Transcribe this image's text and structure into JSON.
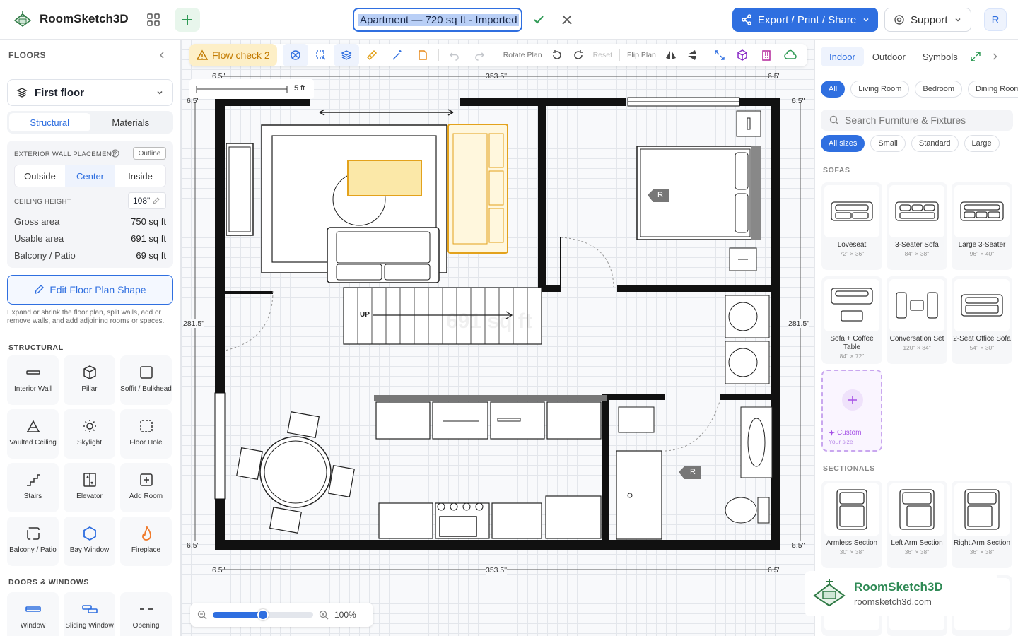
{
  "app": {
    "name": "RoomSketch3D",
    "title": "Apartment — 720 sq ft - Imported",
    "export_label": "Export / Print / Share",
    "support_label": "Support",
    "avatar_initial": "R",
    "accent": "#2f6fe0"
  },
  "left": {
    "heading": "FLOORS",
    "floor": "First floor",
    "tabs": [
      "Structural",
      "Materials"
    ],
    "wall_label": "EXTERIOR WALL PLACEMENT",
    "outline_btn": "Outline",
    "placement": [
      "Outside",
      "Center",
      "Inside"
    ],
    "ceiling_label": "CEILING HEIGHT",
    "ceiling_value": "108\"",
    "stats": [
      {
        "label": "Gross area",
        "value": "750 sq ft"
      },
      {
        "label": "Usable area",
        "value": "691 sq ft"
      },
      {
        "label": "Balcony / Patio",
        "value": "69 sq ft"
      }
    ],
    "edit_btn": "Edit Floor Plan Shape",
    "help": "Expand or shrink the floor plan, split walls, add or remove walls, and add adjoining rooms or spaces.",
    "structural_heading": "STRUCTURAL",
    "structural": [
      "Interior Wall",
      "Pillar",
      "Soffit / Bulkhead",
      "Vaulted Ceiling",
      "Skylight",
      "Floor Hole",
      "Stairs",
      "Elevator",
      "Add Room",
      "Balcony / Patio",
      "Bay Window",
      "Fireplace"
    ],
    "doors_heading": "DOORS & WINDOWS",
    "doors": [
      "Window",
      "Sliding Window",
      "Opening"
    ]
  },
  "toolbar": {
    "flow_check": "Flow check 2",
    "rotate_plan": "Rotate Plan",
    "reset": "Reset",
    "flip_plan": "Flip Plan"
  },
  "plan": {
    "dim_top": "353.5\"",
    "dim_bottom": "353.5\"",
    "dim_left": "281.5\"",
    "dim_right": "281.5\"",
    "corner": "6.5\"",
    "scale": "5 ft",
    "stairs_label": "UP",
    "area_overlay": "691 sq ft",
    "door_tag": "R"
  },
  "zoom": {
    "value": "100%",
    "fraction": 0.5
  },
  "right": {
    "tabs": [
      "Indoor",
      "Outdoor",
      "Symbols"
    ],
    "rooms": [
      "All",
      "Living Room",
      "Bedroom",
      "Dining Room"
    ],
    "search_placeholder": "Search Furniture & Fixtures",
    "sizes": [
      "All sizes",
      "Small",
      "Standard",
      "Large"
    ],
    "sofas_heading": "SOFAS",
    "sofas": [
      {
        "name": "Loveseat",
        "size": "72\" × 36\""
      },
      {
        "name": "3-Seater Sofa",
        "size": "84\" × 38\""
      },
      {
        "name": "Large 3-Seater",
        "size": "96\" × 40\""
      },
      {
        "name": "Sofa + Coffee Table",
        "size": "84\" × 72\""
      },
      {
        "name": "Conversation Set",
        "size": "120\" × 84\""
      },
      {
        "name": "2-Seat Office Sofa",
        "size": "54\" × 30\""
      }
    ],
    "custom_label": "Custom",
    "custom_sub": "Your size",
    "sectionals_heading": "SECTIONALS",
    "sectionals": [
      {
        "name": "Armless Section",
        "size": "30\" × 38\""
      },
      {
        "name": "Left Arm Section",
        "size": "36\" × 38\""
      },
      {
        "name": "Right Arm Section",
        "size": "36\" × 38\""
      }
    ]
  },
  "watermark": {
    "name": "RoomSketch3D",
    "url": "roomsketch3d.com"
  }
}
